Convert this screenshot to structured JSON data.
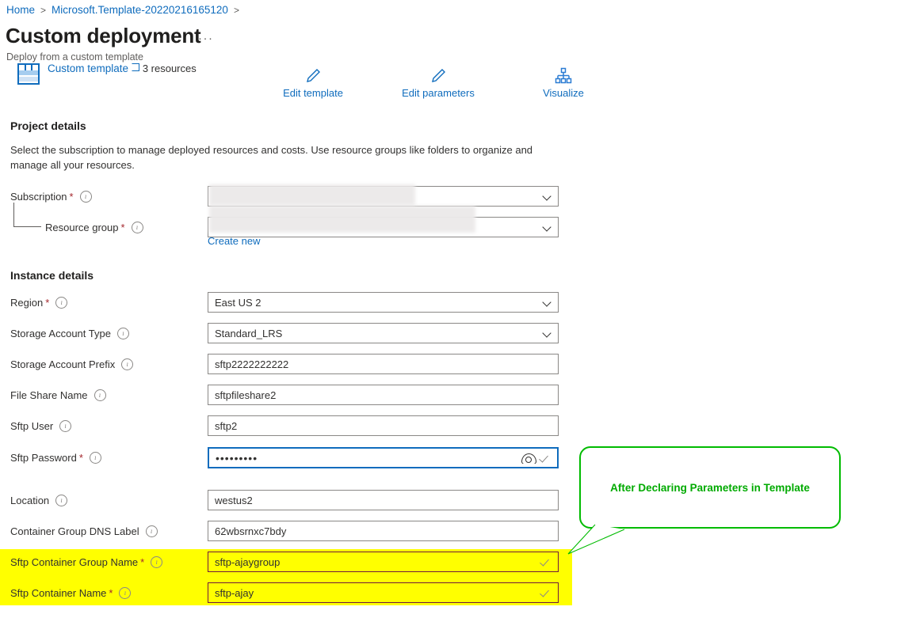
{
  "breadcrumb": {
    "home": "Home",
    "template": "Microsoft.Template-20220216165120",
    "separator": ">"
  },
  "header": {
    "title": "Custom deployment",
    "subtitle": "Deploy from a custom template",
    "more_menu": "···"
  },
  "template_summary": {
    "name": "Custom template",
    "resources": "3 resources"
  },
  "commands": [
    {
      "label": "Edit template",
      "icon": "pencil-icon"
    },
    {
      "label": "Edit parameters",
      "icon": "pencil-icon"
    },
    {
      "label": "Visualize",
      "icon": "hierarchy-icon"
    }
  ],
  "project_details": {
    "heading": "Project details",
    "description": "Select the subscription to manage deployed resources and costs. Use resource groups like folders to organize and manage all your resources.",
    "create_new": "Create new",
    "fields": [
      {
        "label": "Subscription",
        "required": true,
        "value": "",
        "control": "dropdown",
        "redacted": true
      },
      {
        "label": "Resource group",
        "required": true,
        "value": "",
        "control": "dropdown",
        "redacted": true,
        "indent": true
      }
    ]
  },
  "instance_details": {
    "heading": "Instance details",
    "fields": [
      {
        "label": "Region",
        "required": true,
        "value": "East US 2",
        "control": "dropdown"
      },
      {
        "label": "Storage Account Type",
        "required": false,
        "value": "Standard_LRS",
        "control": "dropdown"
      },
      {
        "label": "Storage Account Prefix",
        "required": false,
        "value": "sftp2222222222",
        "control": "text"
      },
      {
        "label": "File Share Name",
        "required": false,
        "value": "sftpfileshare2",
        "control": "text"
      },
      {
        "label": "Sftp User",
        "required": false,
        "value": "sftp2",
        "control": "text"
      },
      {
        "label": "Sftp Password",
        "required": true,
        "value": "•••••••••",
        "control": "password",
        "focused": true
      },
      {
        "label": "Location",
        "required": false,
        "value": "westus2",
        "control": "text"
      },
      {
        "label": "Container Group DNS Label",
        "required": false,
        "value": "62wbsrnxc7bdy",
        "control": "text"
      },
      {
        "label": "Sftp Container Group Name",
        "required": true,
        "value": "sftp-ajaygroup",
        "control": "text",
        "valid": true,
        "highlighted": true
      },
      {
        "label": "Sftp Container Name",
        "required": true,
        "value": "sftp-ajay",
        "control": "text",
        "valid": true,
        "highlighted": true
      }
    ]
  },
  "annotation": {
    "text": "After Declaring Parameters in Template",
    "color": "#00aa00",
    "highlight_color": "#ffff00"
  },
  "icons": {
    "info": "ı",
    "required_marker": "*"
  }
}
